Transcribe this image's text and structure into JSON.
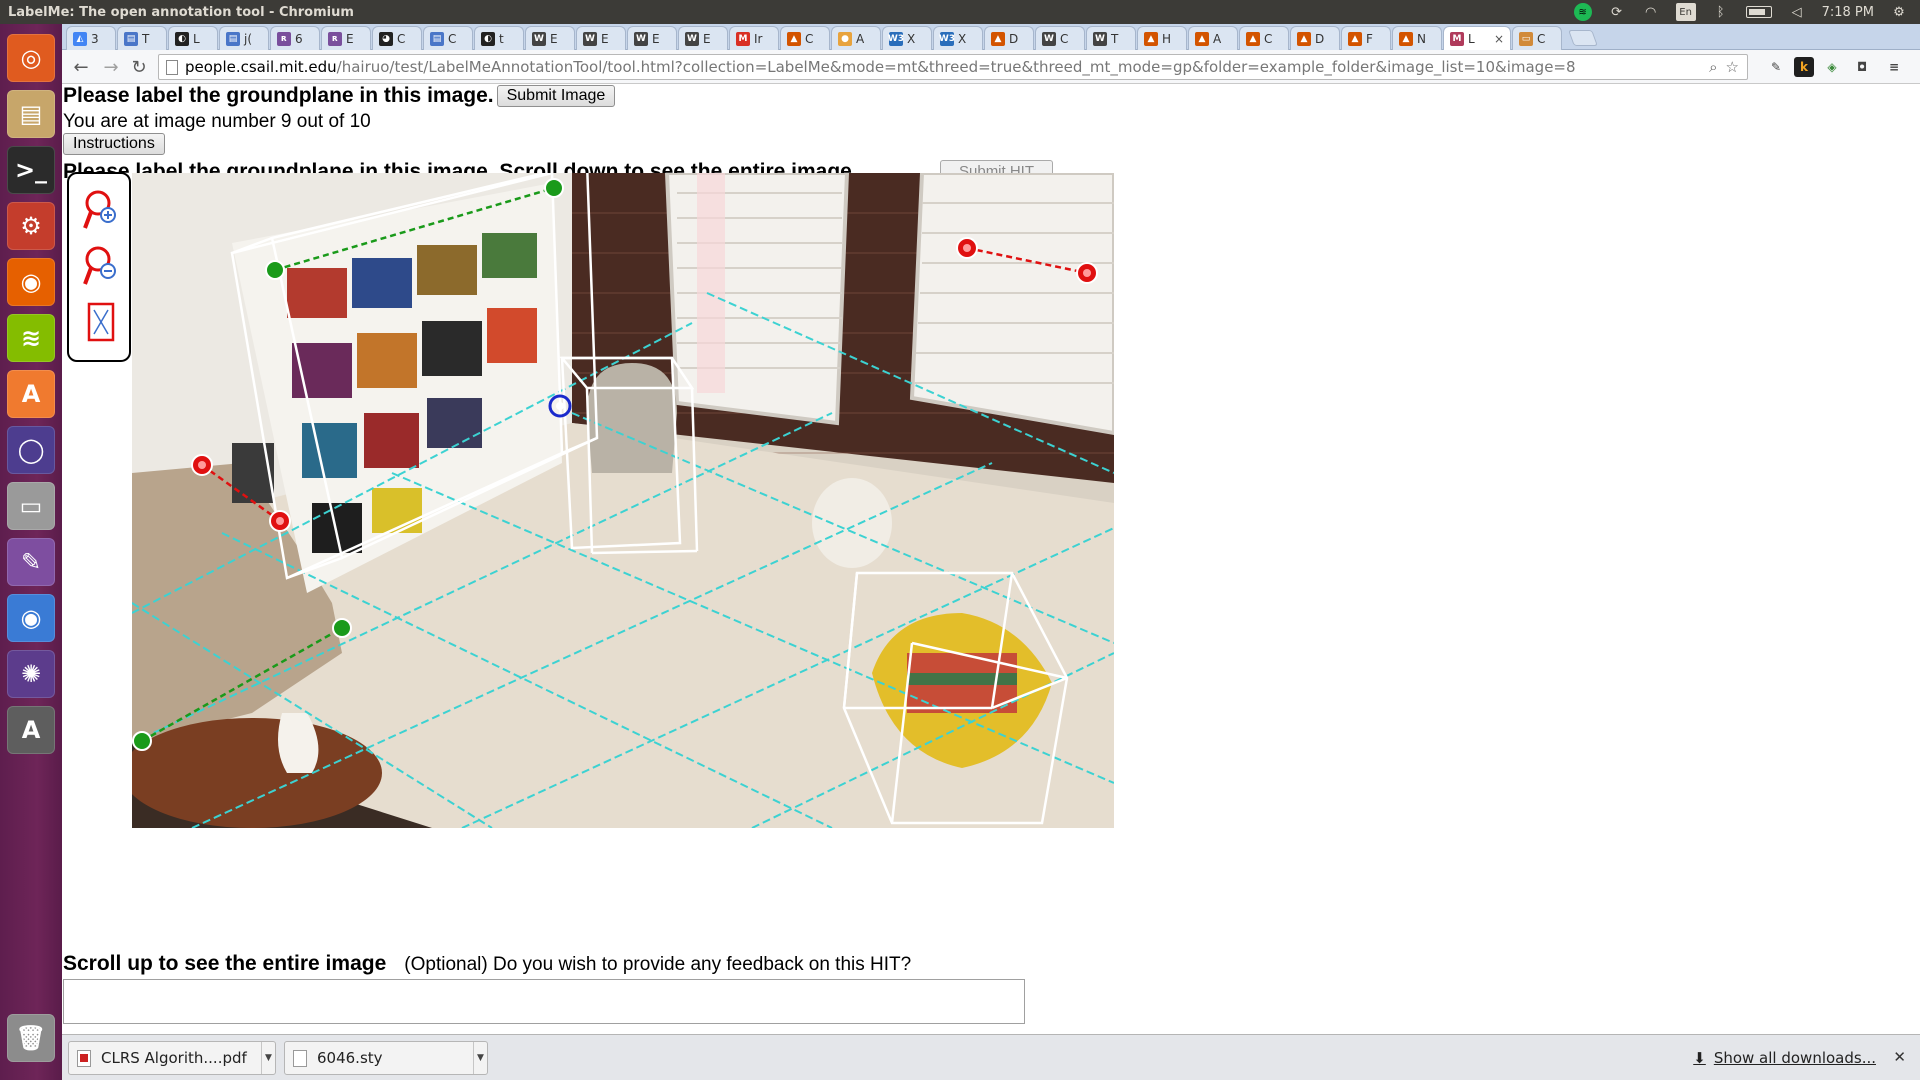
{
  "window": {
    "title": "LabelMe: The open annotation tool - Chromium"
  },
  "panel": {
    "keyboard": "En",
    "clock": "7:18 PM"
  },
  "launcher": {
    "items": [
      {
        "name": "ubuntu-dash-icon",
        "glyph": "◎",
        "color": "#e05b1f"
      },
      {
        "name": "files-icon",
        "glyph": "▤",
        "color": "#c7a66a"
      },
      {
        "name": "terminal-icon",
        "glyph": ">_",
        "color": "#2b2b2b"
      },
      {
        "name": "system-settings-icon",
        "glyph": "⚙",
        "color": "#c43d2c"
      },
      {
        "name": "firefox-icon",
        "glyph": "◉",
        "color": "#e66000"
      },
      {
        "name": "spotify-icon",
        "glyph": "≋",
        "color": "#84bd00"
      },
      {
        "name": "software-center-icon",
        "glyph": "A",
        "color": "#f07a2f"
      },
      {
        "name": "app-ring-icon",
        "glyph": "◯",
        "color": "#4d3d8f"
      },
      {
        "name": "drive-icon",
        "glyph": "▭",
        "color": "#9a9a9a"
      },
      {
        "name": "texteditor-icon",
        "glyph": "✎",
        "color": "#7e4ea0"
      },
      {
        "name": "chromium-icon",
        "glyph": "◉",
        "color": "#3a7bd5"
      },
      {
        "name": "shotwell-icon",
        "glyph": "✺",
        "color": "#5c3c8c"
      },
      {
        "name": "software-updater-icon",
        "glyph": "A",
        "color": "#5e5e5e"
      },
      {
        "name": "trash-icon",
        "glyph": "🗑",
        "color": "#8c8c8c"
      }
    ]
  },
  "tabs": [
    {
      "fav": "◭",
      "favColor": "#4285f4",
      "label": "3"
    },
    {
      "fav": "▤",
      "favColor": "#4a76c8",
      "label": "T"
    },
    {
      "fav": "◐",
      "favColor": "#222222",
      "label": "L"
    },
    {
      "fav": "▤",
      "favColor": "#4a76c8",
      "label": "j("
    },
    {
      "fav": "ʀ",
      "favColor": "#7a4f9c",
      "label": "6"
    },
    {
      "fav": "ʀ",
      "favColor": "#7a4f9c",
      "label": "E"
    },
    {
      "fav": "◕",
      "favColor": "#222222",
      "label": "C"
    },
    {
      "fav": "▤",
      "favColor": "#4a76c8",
      "label": "C"
    },
    {
      "fav": "◐",
      "favColor": "#222222",
      "label": "t"
    },
    {
      "fav": "W",
      "favColor": "#444444",
      "label": "E"
    },
    {
      "fav": "W",
      "favColor": "#444444",
      "label": "E"
    },
    {
      "fav": "W",
      "favColor": "#444444",
      "label": "E"
    },
    {
      "fav": "W",
      "favColor": "#444444",
      "label": "E"
    },
    {
      "fav": "M",
      "favColor": "#d93025",
      "label": "Ir"
    },
    {
      "fav": "▲",
      "favColor": "#d35400",
      "label": "C"
    },
    {
      "fav": "●",
      "favColor": "#e8a33d",
      "label": "A"
    },
    {
      "fav": "W3",
      "favColor": "#2a6ebb",
      "label": "X"
    },
    {
      "fav": "W3",
      "favColor": "#2a6ebb",
      "label": "X"
    },
    {
      "fav": "▲",
      "favColor": "#d35400",
      "label": "D"
    },
    {
      "fav": "W",
      "favColor": "#444444",
      "label": "C"
    },
    {
      "fav": "W",
      "favColor": "#444444",
      "label": "T"
    },
    {
      "fav": "▲",
      "favColor": "#d35400",
      "label": "H"
    },
    {
      "fav": "▲",
      "favColor": "#d35400",
      "label": "A"
    },
    {
      "fav": "▲",
      "favColor": "#d35400",
      "label": "C"
    },
    {
      "fav": "▲",
      "favColor": "#d35400",
      "label": "D"
    },
    {
      "fav": "▲",
      "favColor": "#d35400",
      "label": "F"
    },
    {
      "fav": "▲",
      "favColor": "#d35400",
      "label": "N"
    },
    {
      "fav": "M",
      "favColor": "#b03a5b",
      "label": "L",
      "active": true
    },
    {
      "fav": "▭",
      "favColor": "#d18a3a",
      "label": "C"
    }
  ],
  "url": {
    "host": "people.csail.mit.edu",
    "path": "/hairuo/test/LabelMeAnnotationTool/tool.html?collection=LabelMe&mode=mt&threed=true&threed_mt_mode=gp&folder=example_folder&image_list=10&image=8"
  },
  "page": {
    "heading": "Please label the groundplane in this image.",
    "submit_image": "Submit Image",
    "progress": "You are at image number 9 out of 10",
    "instructions": "Instructions",
    "hidden_heading": "Please label the groundplane in this image. Scroll down to see the entire image.",
    "hidden_submit": "Submit HIT",
    "bottom_heading": "Scroll up to see the entire image",
    "feedback_question": "(Optional) Do you wish to provide any feedback on this HIT?",
    "feedback_value": ""
  },
  "tools": [
    {
      "name": "zoom-in-icon"
    },
    {
      "name": "zoom-out-icon"
    },
    {
      "name": "fit-image-icon"
    }
  ],
  "downloads": {
    "items": [
      {
        "label": "CLRS Algorith....pdf",
        "type": "pdf"
      },
      {
        "label": "6046.sty",
        "type": "doc"
      }
    ],
    "show_all": "Show all downloads..."
  },
  "colors": {
    "groundplane": "#3cd2d2",
    "box": "#ffffff",
    "control_red": "#e01010",
    "control_green": "#1a9a1a",
    "control_blue": "#1a2acc"
  }
}
